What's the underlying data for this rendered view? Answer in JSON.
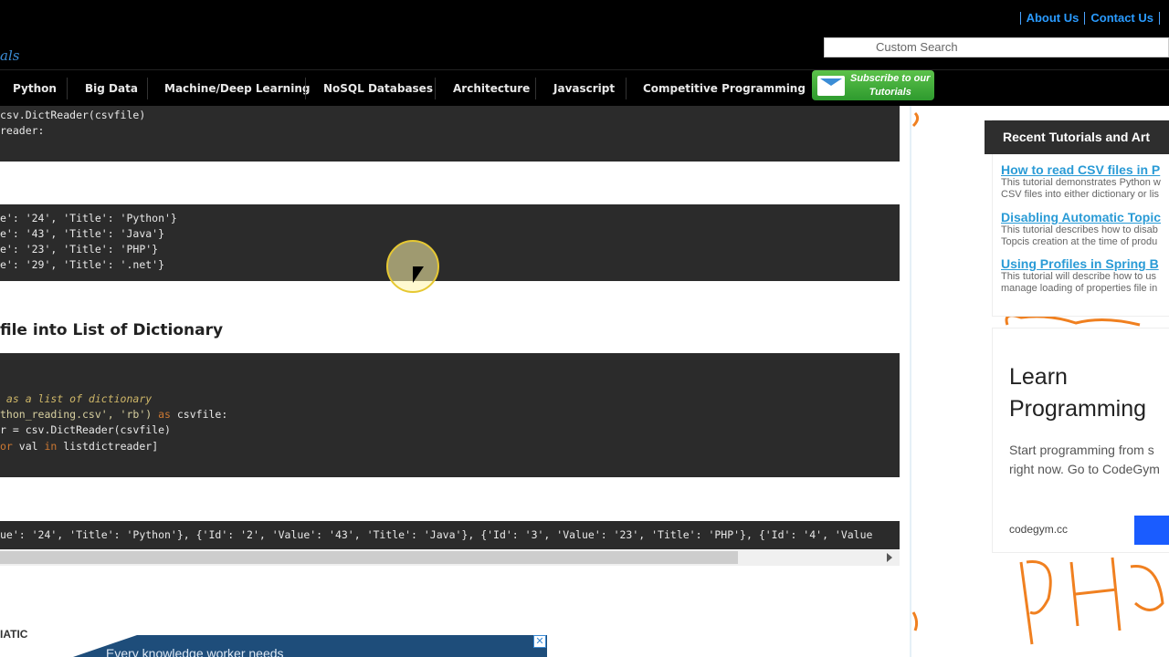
{
  "header": {
    "logo_fragment": "als",
    "links": [
      "About Us",
      "Contact Us"
    ],
    "search_placeholder": "Custom Search"
  },
  "nav": {
    "items": [
      "Python",
      "Big Data",
      "Machine/Deep Learning",
      "NoSQL Databases",
      "Architecture",
      "Javascript",
      "Competitive Programming"
    ],
    "subscribe_line1": "Subscribe to our",
    "subscribe_line2": "Tutorials"
  },
  "code_block_1": {
    "line1": "csv.DictReader(csvfile)",
    "line2": "reader:"
  },
  "output_block_1": {
    "lines": [
      "e': '24', 'Title': 'Python'}",
      "e': '43', 'Title': 'Java'}",
      "e': '23', 'Title': 'PHP'}",
      "e': '29', 'Title': '.net'}"
    ]
  },
  "section_heading": "file into List of Dictionary",
  "code_block_2": {
    "comment": " as a list of dictionary",
    "open_str": "thon_reading.csv', 'rb')",
    "open_kw": " as",
    "open_rest": " csvfile:",
    "reader_line": "r = csv.DictReader(csvfile)",
    "loop_kw": "or",
    "loop_mid": " val ",
    "loop_in": "in",
    "loop_rest": " listdictreader]"
  },
  "output_block_2": {
    "line": "ue': '24', 'Title': 'Python'}, {'Id': '2', 'Value': '43', 'Title': 'Java'}, {'Id': '3', 'Value': '23', 'Title': 'PHP'}, {'Id': '4', 'Value"
  },
  "watermark": "IATIC",
  "bottom_ad": {
    "text": "Every knowledge worker needs",
    "close": "✕"
  },
  "sidebar": {
    "recent_title": "Recent Tutorials and Art",
    "items": [
      {
        "title": "How to read CSV files in P",
        "desc1": "This tutorial demonstrates Python w",
        "desc2": "CSV files into either dictionary or lis"
      },
      {
        "title": "Disabling Automatic Topic",
        "desc1": "This tutorial describes how to disab",
        "desc2": "Topcis creation at the time of produ"
      },
      {
        "title": "Using Profiles in Spring B",
        "desc1": "This tutorial will describe how to us",
        "desc2": "manage loading of properties file in"
      }
    ],
    "ad": {
      "headline1": "Learn",
      "headline2": "Programming",
      "body1": "Start programming from s",
      "body2": "right now. Go to CodeGym",
      "site": "codegym.cc"
    }
  }
}
